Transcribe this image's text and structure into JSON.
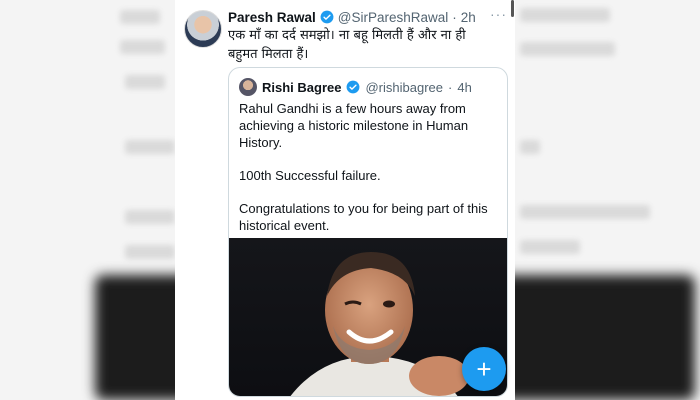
{
  "tweet": {
    "author_name": "Paresh Rawal",
    "author_handle": "@SirPareshRawal",
    "time": "2h",
    "separator": "·",
    "text": "एक माँ का दर्द समझो। ना बहू मिलती हैं और ना ही बहुमत मिलता हैं।",
    "more_icon": "more-icon"
  },
  "quoted_tweet": {
    "author_name": "Rishi Bagree",
    "author_handle": "@rishibagree",
    "time": "4h",
    "separator": "·",
    "paragraphs": [
      "Rahul Gandhi is a few hours away from achieving a historic milestone in Human History.",
      "100th Successful failure.",
      "Congratulations to you for being part of this historical event."
    ]
  },
  "compose_button": {
    "label": "+",
    "color": "#1d9bf0"
  },
  "colors": {
    "verified": "#1d9bf0",
    "text": "#0f1419",
    "muted": "#536471",
    "border": "#cfd9de"
  }
}
